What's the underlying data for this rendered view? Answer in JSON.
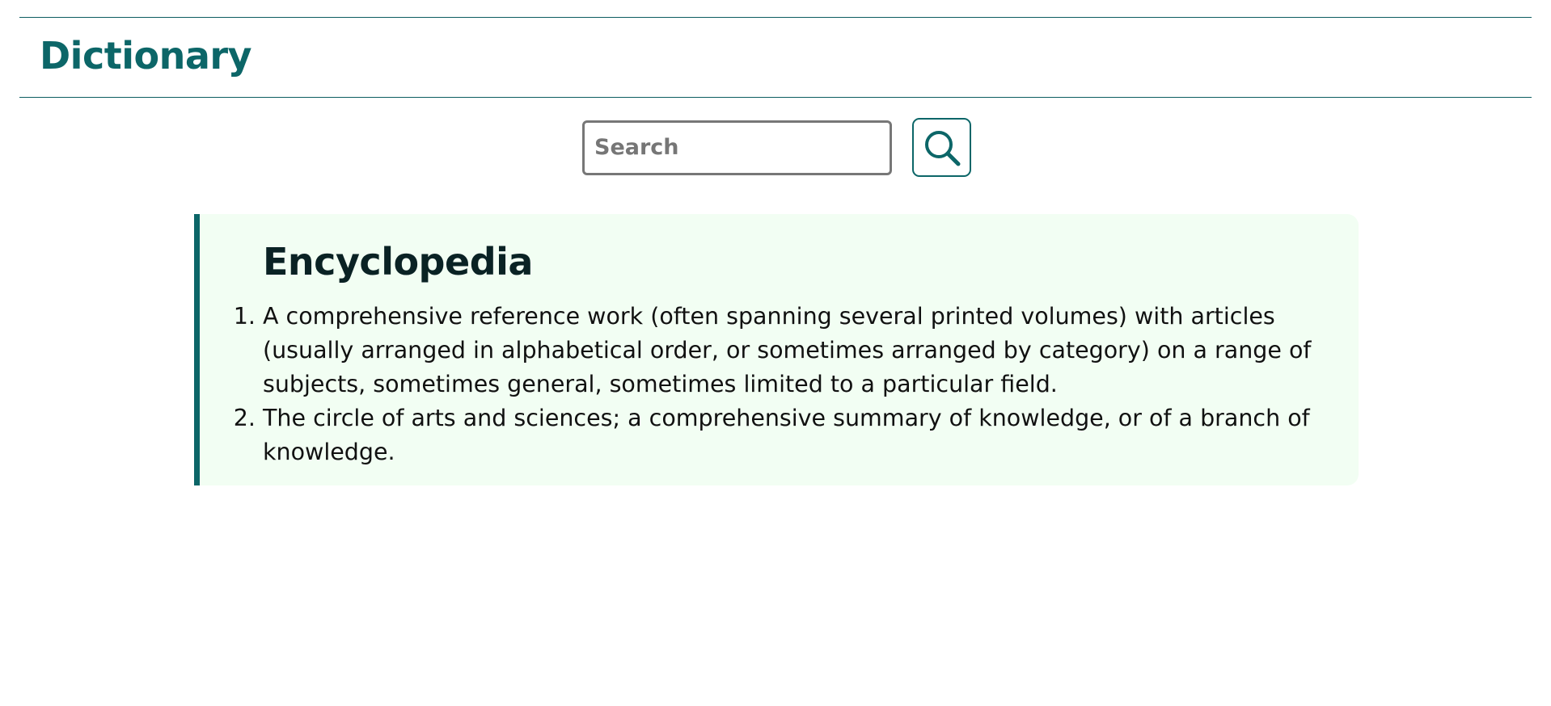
{
  "header": {
    "title": "Dictionary"
  },
  "search": {
    "placeholder": "Search",
    "value": "",
    "button_icon": "search-icon"
  },
  "entry": {
    "word": "Encyclopedia",
    "definitions": [
      "A comprehensive reference work (often spanning several printed volumes) with articles (usually arranged in alphabetical order, or sometimes arranged by category) on a range of subjects, sometimes general, sometimes limited to a particular field.",
      "The circle of arts and sciences; a comprehensive summary of knowledge, or of a branch of knowledge."
    ]
  },
  "colors": {
    "accent": "#0c6668",
    "card_background": "#f2fef3",
    "heading_text": "#0a2224"
  }
}
